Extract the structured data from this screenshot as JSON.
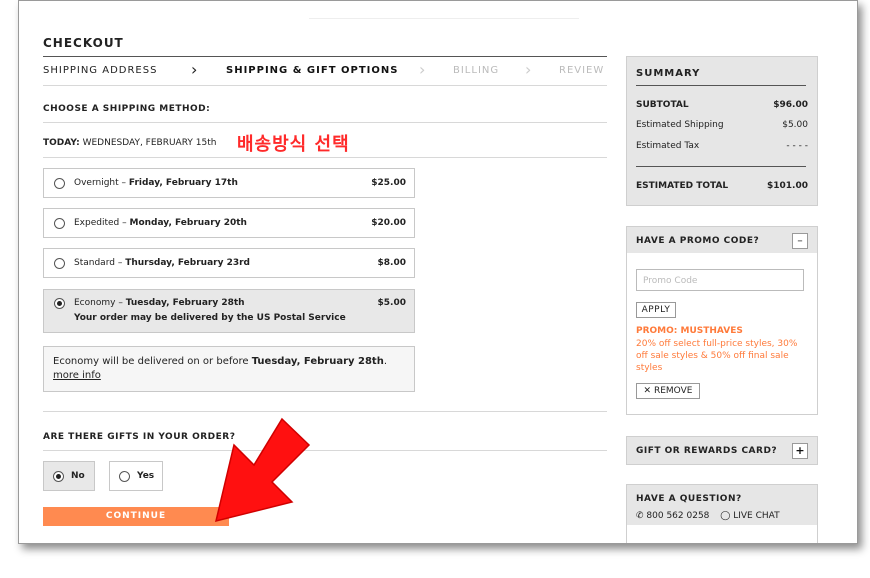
{
  "checkout": {
    "title": "CHECKOUT",
    "steps": [
      {
        "label": "SHIPPING ADDRESS",
        "state": "done"
      },
      {
        "label": "SHIPPING & GIFT OPTIONS",
        "state": "active"
      },
      {
        "label": "BILLING",
        "state": "todo"
      },
      {
        "label": "REVIEW",
        "state": "todo"
      }
    ],
    "choose_method_label": "CHOOSE A SHIPPING METHOD:",
    "today_label": "TODAY:",
    "today_value": "WEDNESDAY, FEBRUARY 15th",
    "annotation_korean": "배송방식 선택",
    "options": [
      {
        "name": "Overnight",
        "date": "Friday, February 17th",
        "price": "$25.00",
        "selected": false
      },
      {
        "name": "Expedited",
        "date": "Monday, February 20th",
        "price": "$20.00",
        "selected": false
      },
      {
        "name": "Standard",
        "date": "Thursday, February 23rd",
        "price": "$8.00",
        "selected": false
      },
      {
        "name": "Economy",
        "date": "Tuesday, February 28th",
        "price": "$5.00",
        "selected": true,
        "note": "Your order may be delivered by the US Postal Service"
      }
    ],
    "dash": " – ",
    "info_text": "Economy will be delivered on or before ",
    "info_date": "Tuesday, February 28th",
    "info_period": ".",
    "info_link": "more info",
    "gifts_question": "ARE THERE GIFTS IN YOUR ORDER?",
    "gift_no": "No",
    "gift_yes": "Yes",
    "gift_selected": "No",
    "continue_label": "CONTINUE"
  },
  "summary": {
    "title": "SUMMARY",
    "subtotal_label": "SUBTOTAL",
    "subtotal_value": "$96.00",
    "shipping_label": "Estimated Shipping",
    "shipping_value": "$5.00",
    "tax_label": "Estimated Tax",
    "tax_value": "- - - -",
    "total_label": "ESTIMATED TOTAL",
    "total_value": "$101.00"
  },
  "promo": {
    "title": "HAVE A PROMO CODE?",
    "toggle": "–",
    "placeholder": "Promo Code",
    "apply_label": "APPLY",
    "code_name": "PROMO: MUSTHAVES",
    "code_desc": "20% off select full-price styles, 30% off sale styles & 50% off final sale styles",
    "remove_label": "REMOVE"
  },
  "gift_card": {
    "title": "GIFT OR REWARDS CARD?",
    "toggle": "+"
  },
  "question": {
    "title": "HAVE A QUESTION?",
    "phone": "800 562 0258",
    "chat": "LIVE CHAT"
  },
  "colors": {
    "accent_orange": "#ff8a50",
    "promo_orange": "#ff7a3a",
    "annotation_red": "#ff2a2a"
  }
}
